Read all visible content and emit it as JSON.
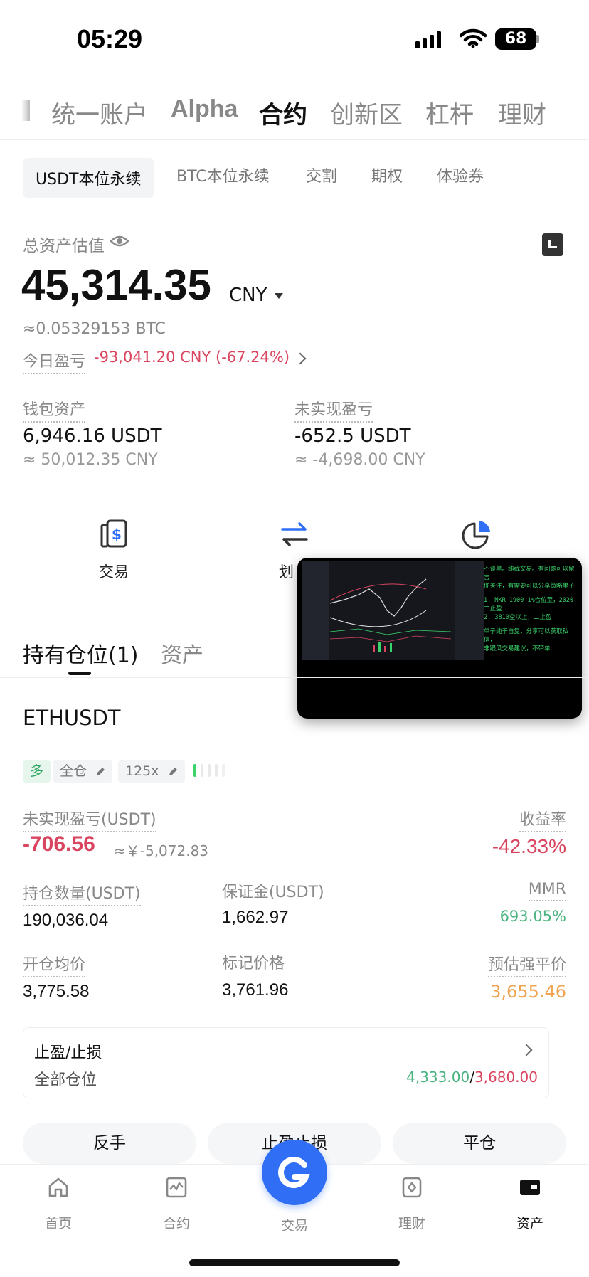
{
  "status": {
    "time": "05:29",
    "battery": "68"
  },
  "top_tabs": [
    {
      "label": "统一账户"
    },
    {
      "label": "Alpha"
    },
    {
      "label": "合约"
    },
    {
      "label": "创新区"
    },
    {
      "label": "杠杆"
    },
    {
      "label": "理财"
    }
  ],
  "sub_tabs": [
    {
      "label": "USDT本位永续"
    },
    {
      "label": "BTC本位永续"
    },
    {
      "label": "交割"
    },
    {
      "label": "期权"
    },
    {
      "label": "体验券"
    }
  ],
  "summary": {
    "total_label": "总资产估值",
    "total_value": "45,314.35",
    "currency": "CNY",
    "btc_approx": "≈0.05329153 BTC",
    "today_pnl_label": "今日盈亏",
    "today_pnl_value": "-93,041.20 CNY (-67.24%)",
    "wallet_label": "钱包资产",
    "wallet_value": "6,946.16 USDT",
    "wallet_cny": "≈ 50,012.35 CNY",
    "unrealized_label": "未实现盈亏",
    "unrealized_value": "-652.5 USDT",
    "unrealized_cny": "≈ -4,698.00 CNY"
  },
  "actions": [
    {
      "label": "交易",
      "icon": "dollar-card-icon"
    },
    {
      "label": "划",
      "icon": "transfer-arrows-icon"
    },
    {
      "label": "",
      "icon": "pie-chart-icon"
    }
  ],
  "pip": {
    "lines": [
      "不谈单。纯截交易。有问题可以留言",
      "你关注，有需要可以分享策略单子",
      "1. MKR 1900 1%合位至，2020二止盈",
      "2. 3810空以上，二止盈",
      "单子纯于自复，分享可以获取私信，",
      "非跟风交易建议，不带单"
    ]
  },
  "positions": {
    "tabs": [
      {
        "label": "持有仓位(1)"
      },
      {
        "label": "资产"
      }
    ],
    "symbol": "ETHUSDT",
    "tags": {
      "side": "多",
      "margin_mode": "全仓",
      "leverage": "125x"
    },
    "unrealized_label": "未实现盈亏(USDT)",
    "unrealized_value": "-706.56",
    "unrealized_cny": "≈￥-5,072.83",
    "roe_label": "收益率",
    "roe_value": "-42.33%",
    "size_label": "持仓数量(USDT)",
    "size_value": "190,036.04",
    "margin_label": "保证金(USDT)",
    "margin_value": "1,662.97",
    "mmr_label": "MMR",
    "mmr_value": "693.05%",
    "entry_label": "开仓均价",
    "entry_value": "3,775.58",
    "mark_label": "标记价格",
    "mark_value": "3,761.96",
    "liq_label": "预估强平价",
    "liq_value": "3,655.46",
    "sltp_title": "止盈/止损",
    "sltp_scope": "全部仓位",
    "tp_value": "4,333.00",
    "sl_value": "3,680.00",
    "sep": "/",
    "buttons": {
      "reverse": "反手",
      "sltp": "止盈止损",
      "close": "平仓"
    }
  },
  "nav": [
    {
      "label": "首页",
      "icon": "home-icon"
    },
    {
      "label": "合约",
      "icon": "chart-icon"
    },
    {
      "label": "交易",
      "icon": "trade-logo-icon"
    },
    {
      "label": "理财",
      "icon": "earn-icon"
    },
    {
      "label": "资产",
      "icon": "wallet-icon"
    }
  ],
  "colors": {
    "red": "#d9455f",
    "green": "#4bb380",
    "orange": "#f0a451",
    "brand": "#2f6ef5"
  }
}
